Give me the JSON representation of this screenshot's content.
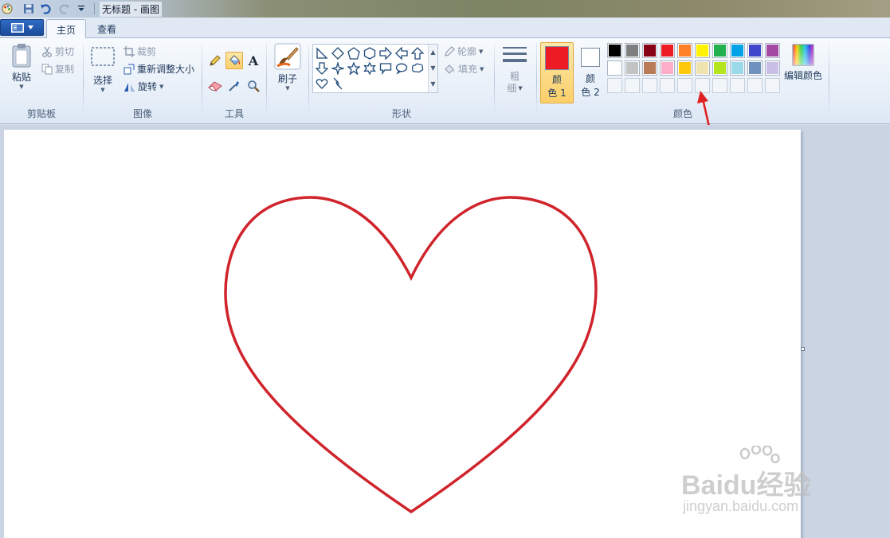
{
  "window": {
    "title": "无标题 - 画图"
  },
  "tabs": [
    {
      "label": "主页",
      "active": true
    },
    {
      "label": "查看",
      "active": false
    }
  ],
  "clipboard": {
    "paste": "粘贴",
    "cut": "剪切",
    "copy": "复制",
    "group_label": "剪贴板"
  },
  "image": {
    "select": "选择",
    "crop": "裁剪",
    "resize": "重新调整大小",
    "rotate": "旋转",
    "group_label": "图像"
  },
  "tools": {
    "group_label": "工具",
    "items": [
      "pencil-icon",
      "fill-bucket-icon",
      "text-icon",
      "eraser-icon",
      "color-picker-icon",
      "magnifier-icon"
    ],
    "active": "fill-bucket-icon"
  },
  "brushes": {
    "label": "刷子"
  },
  "shapes": {
    "group_label": "形状",
    "outline": "轮廓",
    "fill": "填充"
  },
  "size": {
    "label_line1": "粗",
    "label_line2": "细"
  },
  "colors": {
    "group_label": "颜色",
    "color1_line1": "颜",
    "color1_line2": "色 1",
    "color2_line1": "颜",
    "color2_line2": "色 2",
    "color1_value": "#ed1c24",
    "color2_value": "#ffffff",
    "edit_colors": "编辑颜色",
    "row1": [
      "#000000",
      "#7f7f7f",
      "#880015",
      "#ed1c24",
      "#ff7f27",
      "#fff200",
      "#22b14c",
      "#00a2e8",
      "#3f48cc",
      "#a349a4"
    ],
    "row2": [
      "#ffffff",
      "#c3c3c3",
      "#b97a57",
      "#ffaec9",
      "#ffc90e",
      "#efe4b0",
      "#b5e61d",
      "#99d9ea",
      "#7092be",
      "#c8bfe7"
    ],
    "row3_empty_count": 10
  },
  "annotation": {
    "arrow_color": "#e02020"
  },
  "drawing": {
    "shape": "heart",
    "stroke_color": "#d0242c"
  },
  "watermark": {
    "brand": "Baidu经验",
    "url": "jingyan.baidu.com"
  }
}
